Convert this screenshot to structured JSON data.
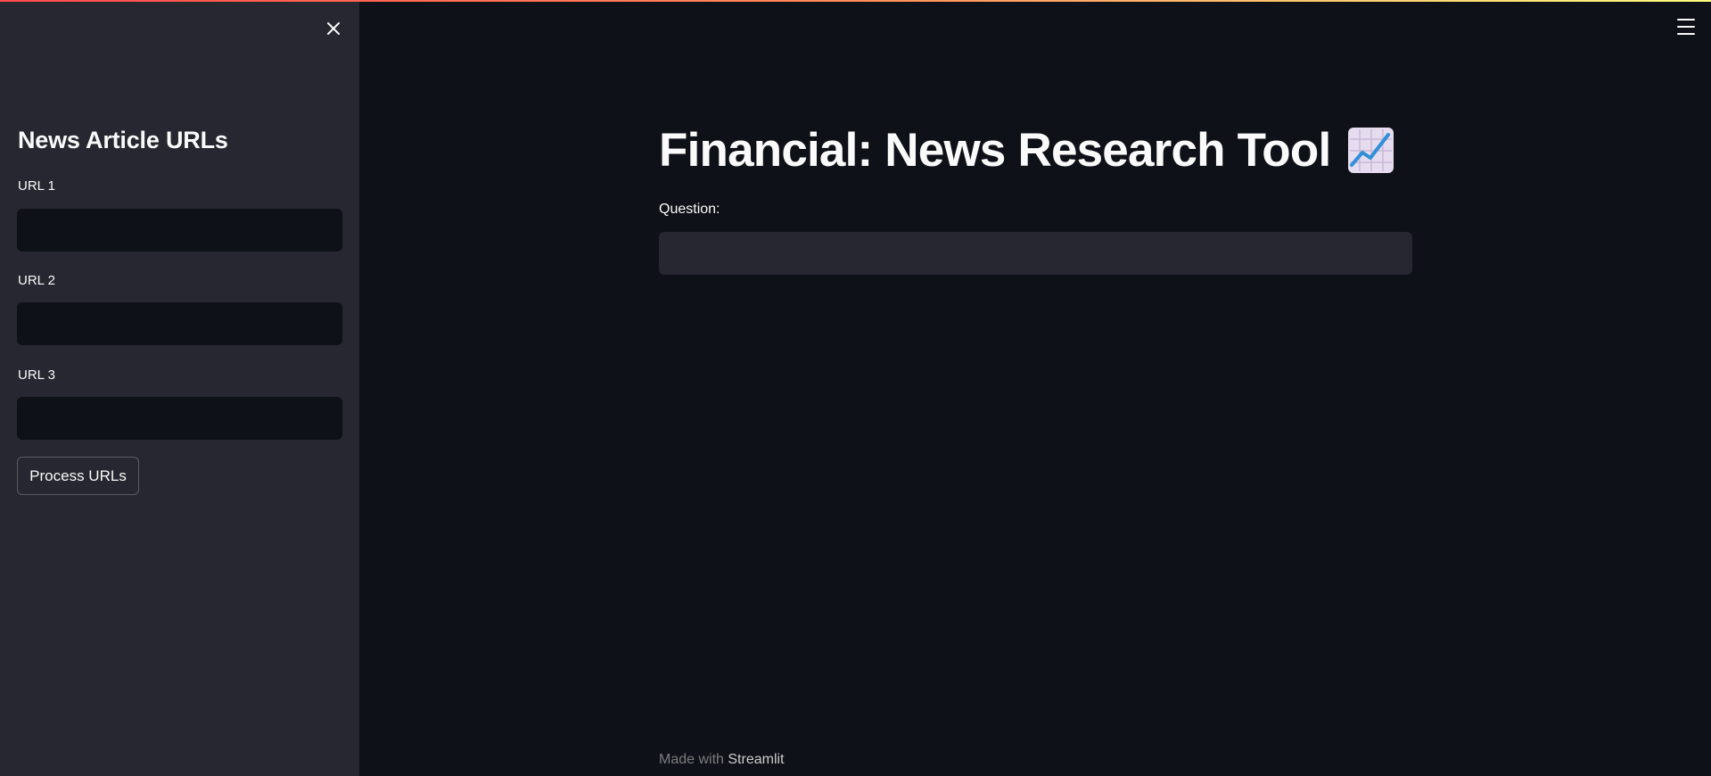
{
  "sidebar": {
    "title": "News Article URLs",
    "url_fields": [
      {
        "label": "URL 1",
        "value": ""
      },
      {
        "label": "URL 2",
        "value": ""
      },
      {
        "label": "URL 3",
        "value": ""
      }
    ],
    "process_button_label": "Process URLs"
  },
  "main": {
    "title": "Financial: News Research Tool",
    "title_icon": "chart-increasing-icon",
    "question_label": "Question:",
    "question_value": ""
  },
  "footer": {
    "prefix": "Made with",
    "brand": "Streamlit"
  },
  "colors": {
    "background": "#0e1117",
    "sidebar": "#262730",
    "text": "#fafafa",
    "accent_gradient_start": "#ff4b4b",
    "accent_gradient_end": "#fffd80"
  }
}
